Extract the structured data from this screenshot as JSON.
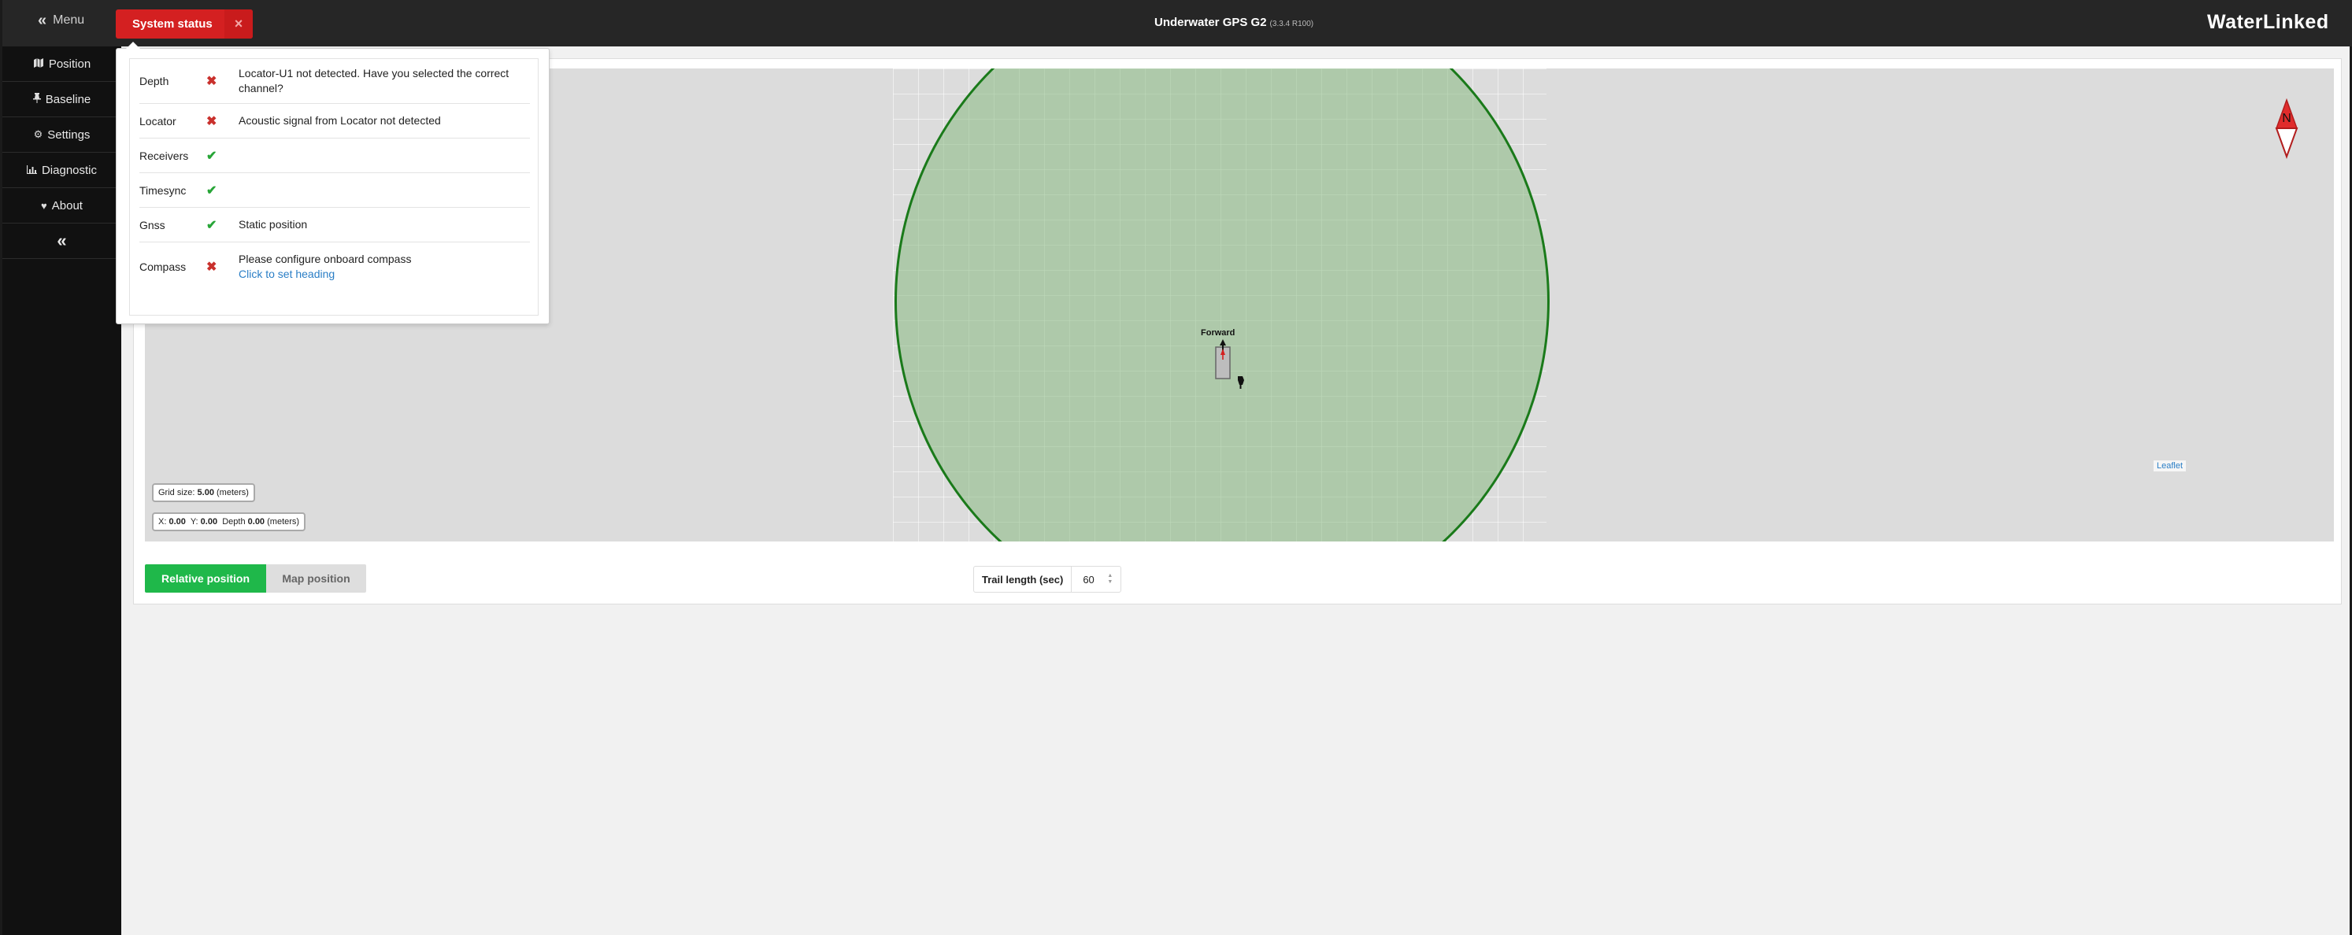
{
  "topbar": {
    "menu_label": "Menu",
    "status_button_label": "System status",
    "status_close": "×",
    "title": "Underwater GPS G2",
    "version": "(3.3.4 R100)",
    "brand": "WaterLinked"
  },
  "sidebar": {
    "items": [
      {
        "label": "Position",
        "icon": "map-icon"
      },
      {
        "label": "Baseline",
        "icon": "pin-icon"
      },
      {
        "label": "Settings",
        "icon": "gears-icon"
      },
      {
        "label": "Diagnostic",
        "icon": "chart-icon"
      },
      {
        "label": "About",
        "icon": "heart-icon"
      }
    ],
    "collapse_label": "«"
  },
  "system_status": {
    "rows": [
      {
        "name": "Depth",
        "state": "error",
        "message": "Locator-U1 not detected. Have you selected the correct channel?"
      },
      {
        "name": "Locator",
        "state": "error",
        "message": "Acoustic signal from Locator not detected"
      },
      {
        "name": "Receivers",
        "state": "ok",
        "message": ""
      },
      {
        "name": "Timesync",
        "state": "ok",
        "message": ""
      },
      {
        "name": "Gnss",
        "state": "ok",
        "message": "Static position"
      },
      {
        "name": "Compass",
        "state": "error",
        "message": "Please configure onboard compass",
        "link": "Click to set heading"
      }
    ],
    "error_mark": "✖",
    "ok_mark": "✔",
    "colors": {
      "error": "#c9302c",
      "ok": "#27a537"
    }
  },
  "map": {
    "forward_label": "Forward",
    "compass_label": "N",
    "grid_size": {
      "prefix": "Grid size:",
      "value": "5.00",
      "unit": "(meters)"
    },
    "position": {
      "x_label": "X:",
      "x": "0.00",
      "y_label": "Y:",
      "y": "0.00",
      "depth_label": "Depth",
      "depth": "0.00",
      "unit": "(meters)"
    },
    "attribution": "Leaflet"
  },
  "controls": {
    "relative_position": "Relative position",
    "map_position": "Map position",
    "trail_label": "Trail length (sec)",
    "trail_value": "60"
  }
}
